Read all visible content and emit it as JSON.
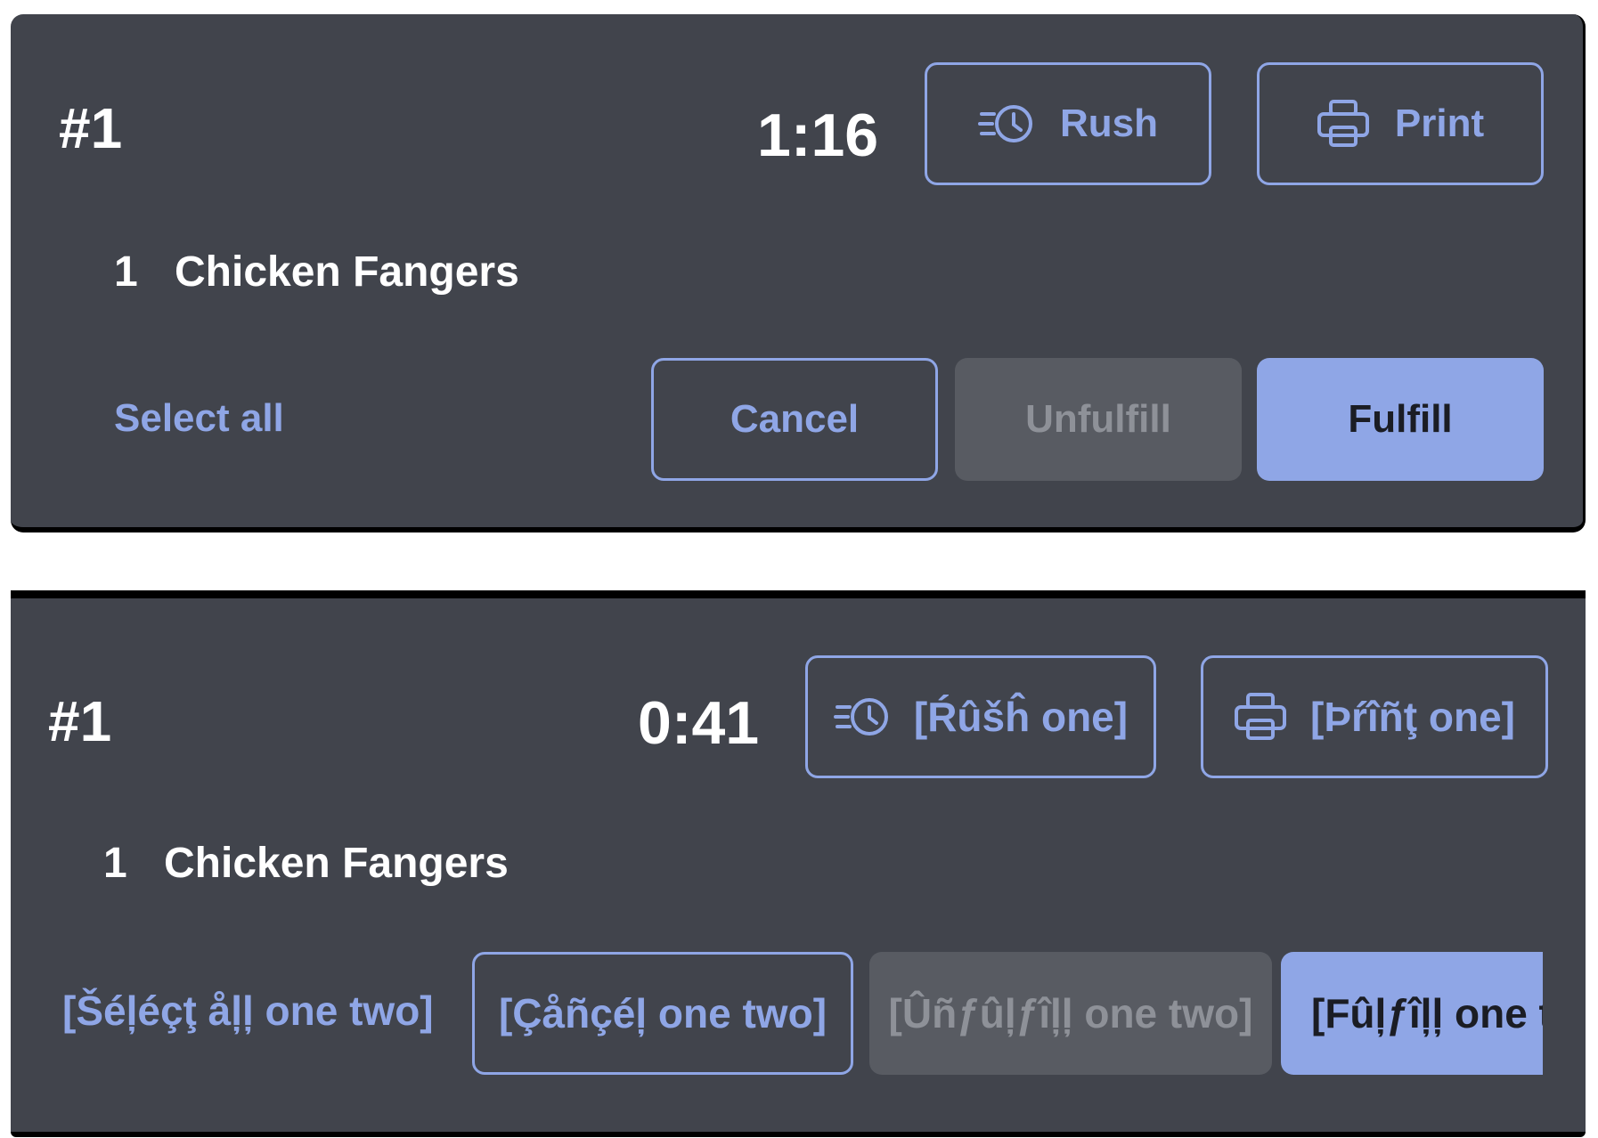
{
  "cards": [
    {
      "order_number": "#1",
      "timer": "1:16",
      "rush_label": "Rush",
      "print_label": "Print",
      "item": {
        "qty": "1",
        "name": "Chicken Fangers"
      },
      "select_all_label": "Select all",
      "cancel_label": "Cancel",
      "unfulfill_label": "Unfulfill",
      "fulfill_label": "Fulfill"
    },
    {
      "order_number": "#1",
      "timer": "0:41",
      "rush_label": "[Ŕûšĥ one]",
      "print_label": "[Þŕîñţ one]",
      "item": {
        "qty": "1",
        "name": "Chicken Fangers"
      },
      "select_all_label": "[Šéļéçţ åļļ one two]",
      "cancel_label": "[Çåñçéļ one two]",
      "unfulfill_label": "[Ûñƒûļƒîļļ one two]",
      "fulfill_label": "[Fûļƒîļļ one two]"
    }
  ],
  "icons": {
    "rush": "rush-clock-icon",
    "print": "printer-icon"
  },
  "colors": {
    "card_bg": "#41444c",
    "accent": "#8fa6e6",
    "disabled_bg": "#585b62",
    "text": "#ffffff"
  }
}
